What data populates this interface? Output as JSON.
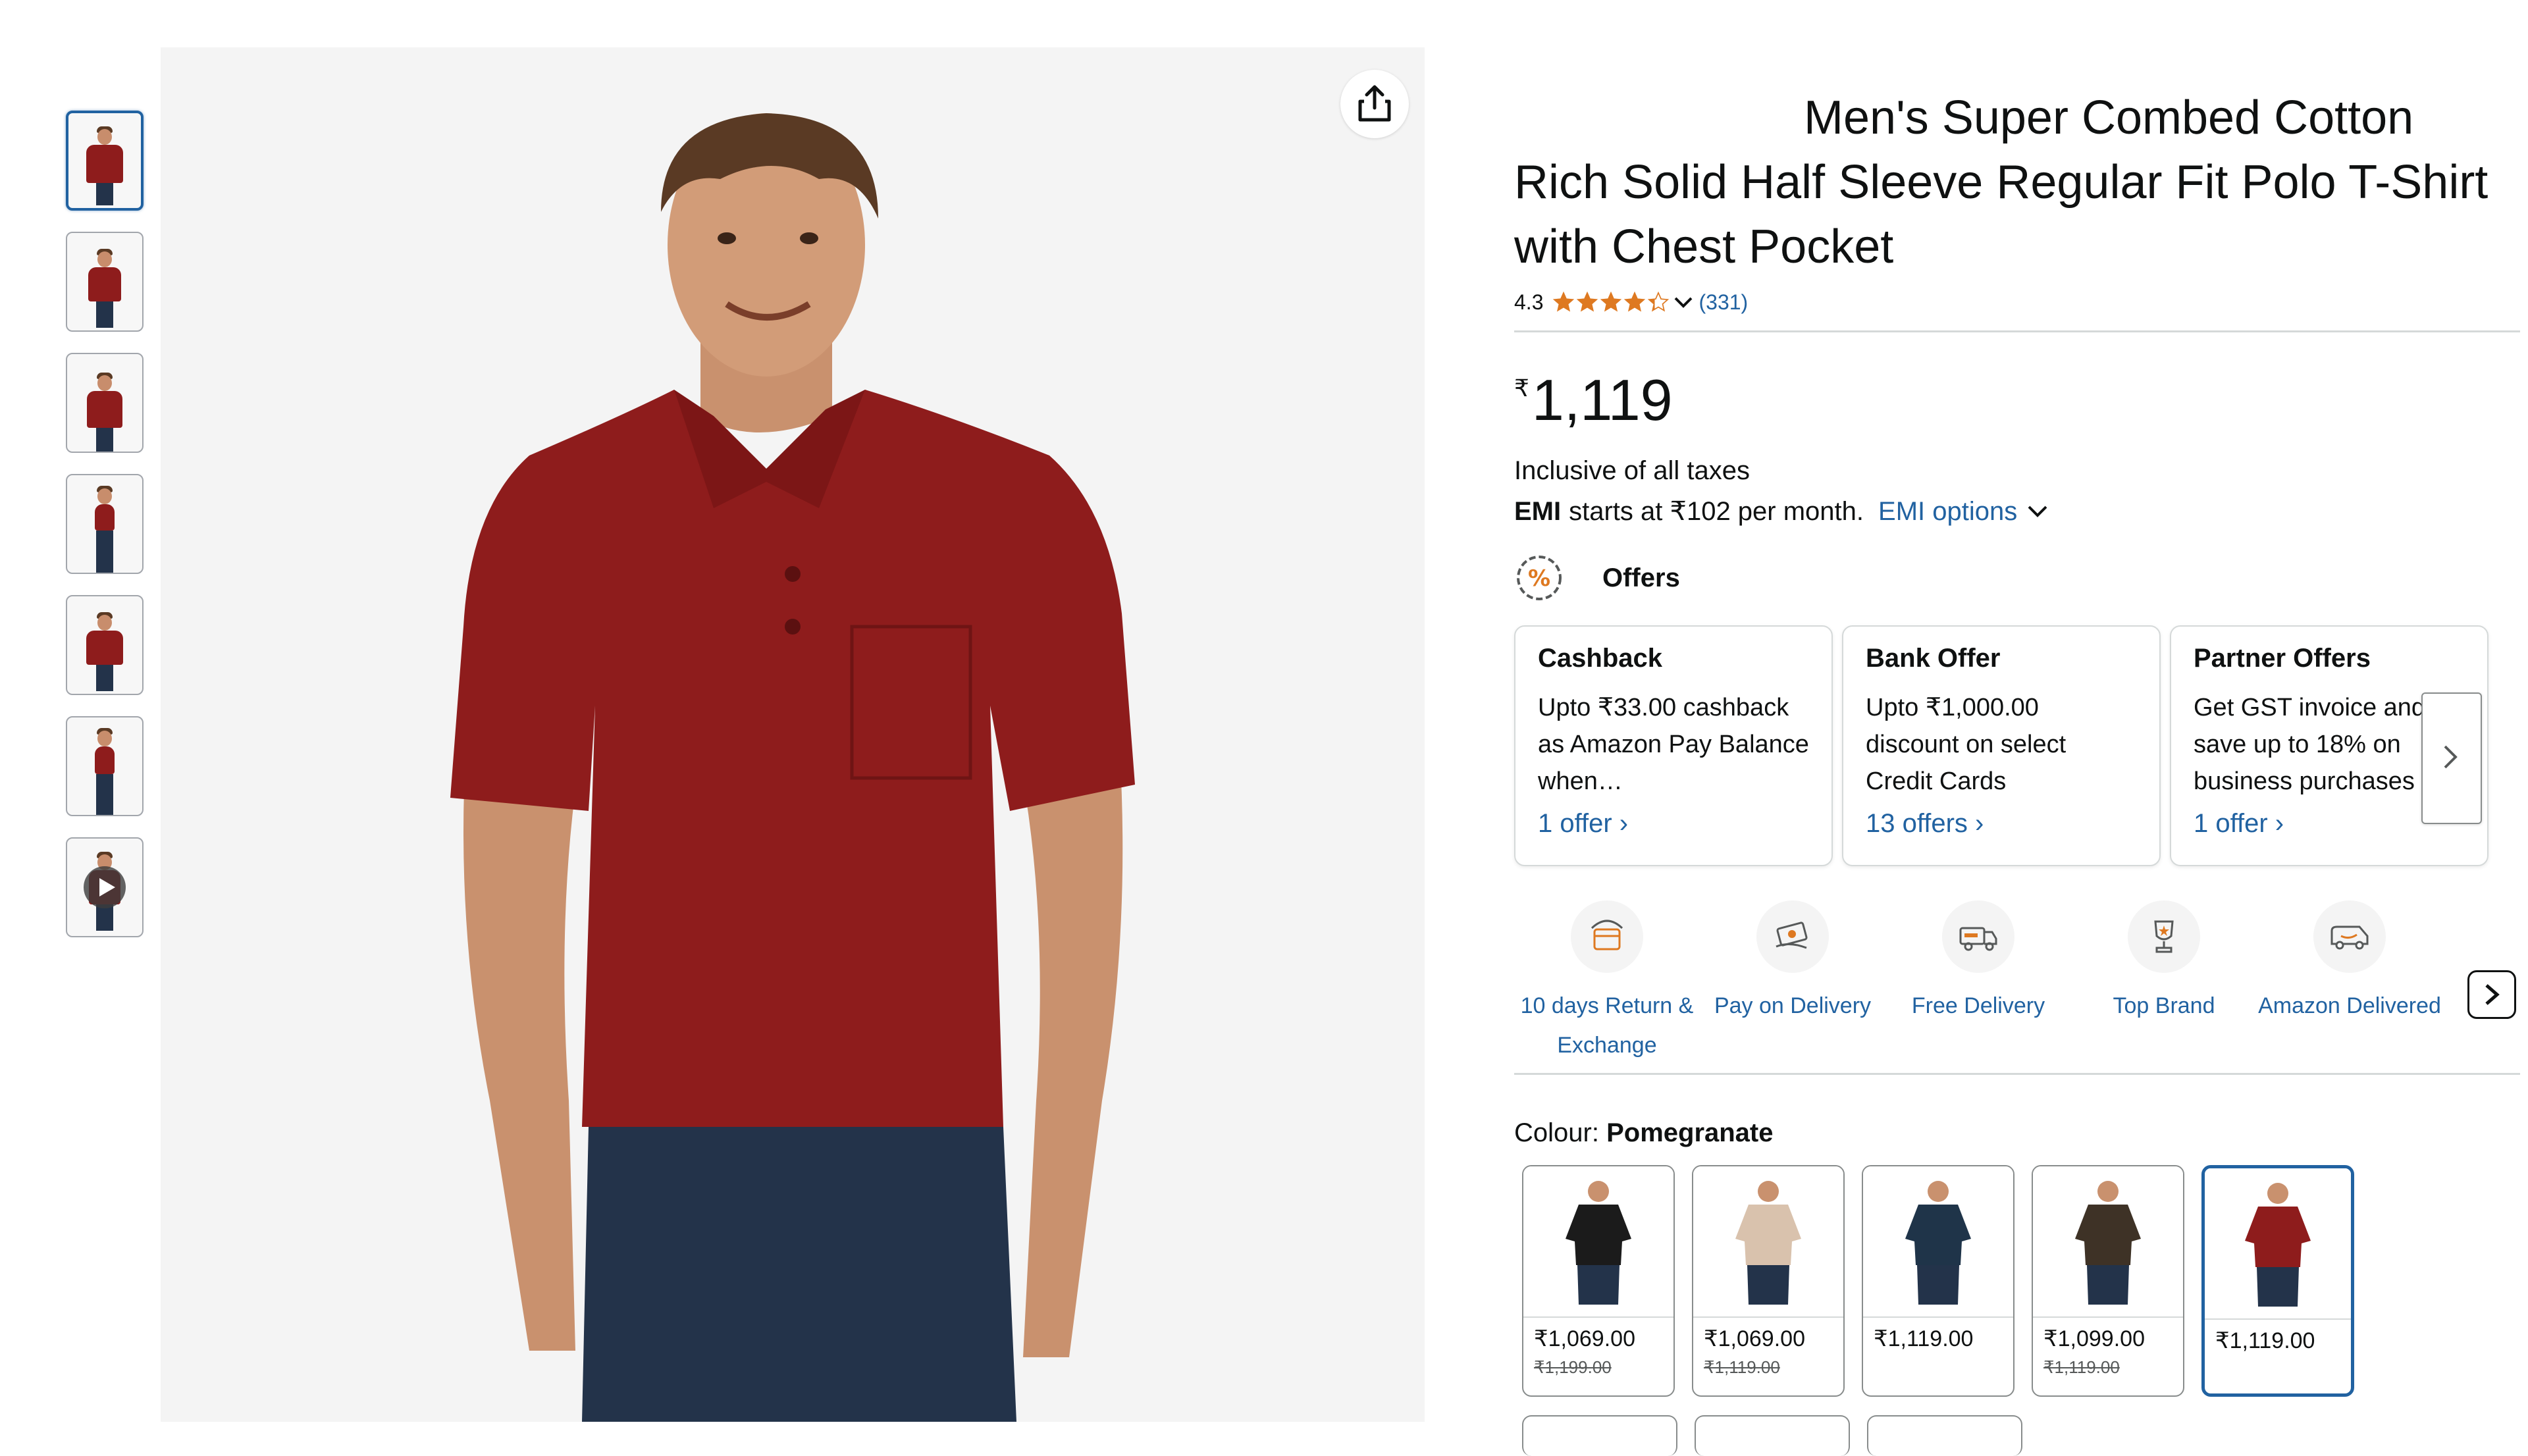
{
  "gallery": {
    "thumbnails": [
      {
        "label": "thumbnail-1",
        "active": true
      },
      {
        "label": "thumbnail-2",
        "active": false
      },
      {
        "label": "thumbnail-3",
        "active": false
      },
      {
        "label": "thumbnail-4",
        "active": false
      },
      {
        "label": "thumbnail-5",
        "active": false
      },
      {
        "label": "thumbnail-6",
        "active": false
      },
      {
        "label": "thumbnail-video",
        "active": false
      }
    ],
    "share_icon": "share-icon"
  },
  "product": {
    "title": "Men's Super Combed Cotton Rich Solid Half Sleeve Regular Fit Polo T-Shirt with Chest Pocket",
    "rating_value": "4.3",
    "rating_stars": 4.3,
    "rating_count": "(331)",
    "price_symbol": "₹",
    "price": "1,119",
    "tax_note": "Inclusive of all taxes",
    "emi_label": "EMI",
    "emi_text": "starts at ₹102 per month.",
    "emi_link": "EMI options"
  },
  "offers": {
    "heading": "Offers",
    "cards": [
      {
        "title": "Cashback",
        "body": "Upto ₹33.00 cashback as Amazon Pay Balance when…",
        "link": "1 offer"
      },
      {
        "title": "Bank Offer",
        "body": "Upto ₹1,000.00 discount on select Credit Cards",
        "link": "13 offers"
      },
      {
        "title": "Partner Offers",
        "body": "Get GST invoice and save up to 18% on business purchases",
        "link": "1 offer"
      }
    ]
  },
  "features": [
    {
      "label": "10 days Return & Exchange",
      "icon": "return-box-icon"
    },
    {
      "label": "Pay on Delivery",
      "icon": "cash-hand-icon"
    },
    {
      "label": "Free Delivery",
      "icon": "delivery-truck-icon"
    },
    {
      "label": "Top Brand",
      "icon": "trophy-icon"
    },
    {
      "label": "Amazon Delivered",
      "icon": "amazon-van-icon"
    }
  ],
  "colour": {
    "label": "Colour:",
    "selected": "Pomegranate",
    "swatches": [
      {
        "price": "₹1,069.00",
        "mrp": "₹1,199.00",
        "shirt_color": "#1b1b1b",
        "selected": false
      },
      {
        "price": "₹1,069.00",
        "mrp": "₹1,119.00",
        "shirt_color": "#d9c2ad",
        "selected": false
      },
      {
        "price": "₹1,119.00",
        "mrp": "",
        "shirt_color": "#1f3449",
        "selected": false
      },
      {
        "price": "₹1,099.00",
        "mrp": "₹1,119.00",
        "shirt_color": "#3e3226",
        "selected": false
      },
      {
        "price": "₹1,119.00",
        "mrp": "",
        "shirt_color": "#8e1c1c",
        "selected": true
      }
    ]
  },
  "colors": {
    "link": "#2162a1",
    "star": "#de7921",
    "shirt": "#8e1c1c",
    "selected_border": "#2162a1"
  }
}
